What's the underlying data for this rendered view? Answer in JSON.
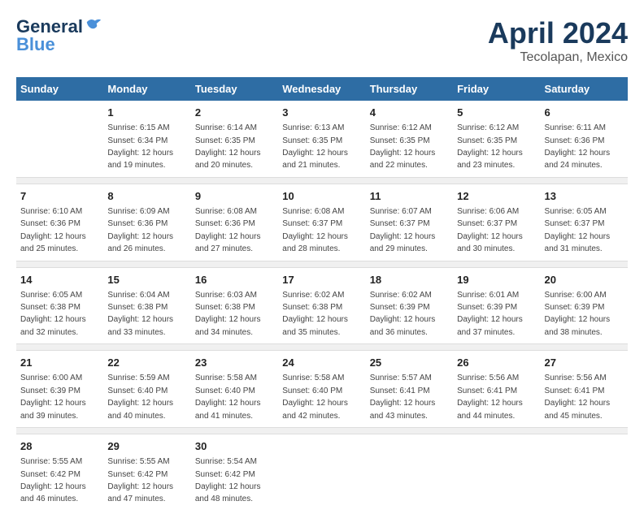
{
  "header": {
    "logo_general": "General",
    "logo_blue": "Blue",
    "title": "April 2024",
    "subtitle": "Tecolapan, Mexico"
  },
  "days_of_week": [
    "Sunday",
    "Monday",
    "Tuesday",
    "Wednesday",
    "Thursday",
    "Friday",
    "Saturday"
  ],
  "weeks": [
    [
      {
        "day": "",
        "sunrise": "",
        "sunset": "",
        "daylight": ""
      },
      {
        "day": "1",
        "sunrise": "Sunrise: 6:15 AM",
        "sunset": "Sunset: 6:34 PM",
        "daylight": "Daylight: 12 hours and 19 minutes."
      },
      {
        "day": "2",
        "sunrise": "Sunrise: 6:14 AM",
        "sunset": "Sunset: 6:35 PM",
        "daylight": "Daylight: 12 hours and 20 minutes."
      },
      {
        "day": "3",
        "sunrise": "Sunrise: 6:13 AM",
        "sunset": "Sunset: 6:35 PM",
        "daylight": "Daylight: 12 hours and 21 minutes."
      },
      {
        "day": "4",
        "sunrise": "Sunrise: 6:12 AM",
        "sunset": "Sunset: 6:35 PM",
        "daylight": "Daylight: 12 hours and 22 minutes."
      },
      {
        "day": "5",
        "sunrise": "Sunrise: 6:12 AM",
        "sunset": "Sunset: 6:35 PM",
        "daylight": "Daylight: 12 hours and 23 minutes."
      },
      {
        "day": "6",
        "sunrise": "Sunrise: 6:11 AM",
        "sunset": "Sunset: 6:36 PM",
        "daylight": "Daylight: 12 hours and 24 minutes."
      }
    ],
    [
      {
        "day": "7",
        "sunrise": "Sunrise: 6:10 AM",
        "sunset": "Sunset: 6:36 PM",
        "daylight": "Daylight: 12 hours and 25 minutes."
      },
      {
        "day": "8",
        "sunrise": "Sunrise: 6:09 AM",
        "sunset": "Sunset: 6:36 PM",
        "daylight": "Daylight: 12 hours and 26 minutes."
      },
      {
        "day": "9",
        "sunrise": "Sunrise: 6:08 AM",
        "sunset": "Sunset: 6:36 PM",
        "daylight": "Daylight: 12 hours and 27 minutes."
      },
      {
        "day": "10",
        "sunrise": "Sunrise: 6:08 AM",
        "sunset": "Sunset: 6:37 PM",
        "daylight": "Daylight: 12 hours and 28 minutes."
      },
      {
        "day": "11",
        "sunrise": "Sunrise: 6:07 AM",
        "sunset": "Sunset: 6:37 PM",
        "daylight": "Daylight: 12 hours and 29 minutes."
      },
      {
        "day": "12",
        "sunrise": "Sunrise: 6:06 AM",
        "sunset": "Sunset: 6:37 PM",
        "daylight": "Daylight: 12 hours and 30 minutes."
      },
      {
        "day": "13",
        "sunrise": "Sunrise: 6:05 AM",
        "sunset": "Sunset: 6:37 PM",
        "daylight": "Daylight: 12 hours and 31 minutes."
      }
    ],
    [
      {
        "day": "14",
        "sunrise": "Sunrise: 6:05 AM",
        "sunset": "Sunset: 6:38 PM",
        "daylight": "Daylight: 12 hours and 32 minutes."
      },
      {
        "day": "15",
        "sunrise": "Sunrise: 6:04 AM",
        "sunset": "Sunset: 6:38 PM",
        "daylight": "Daylight: 12 hours and 33 minutes."
      },
      {
        "day": "16",
        "sunrise": "Sunrise: 6:03 AM",
        "sunset": "Sunset: 6:38 PM",
        "daylight": "Daylight: 12 hours and 34 minutes."
      },
      {
        "day": "17",
        "sunrise": "Sunrise: 6:02 AM",
        "sunset": "Sunset: 6:38 PM",
        "daylight": "Daylight: 12 hours and 35 minutes."
      },
      {
        "day": "18",
        "sunrise": "Sunrise: 6:02 AM",
        "sunset": "Sunset: 6:39 PM",
        "daylight": "Daylight: 12 hours and 36 minutes."
      },
      {
        "day": "19",
        "sunrise": "Sunrise: 6:01 AM",
        "sunset": "Sunset: 6:39 PM",
        "daylight": "Daylight: 12 hours and 37 minutes."
      },
      {
        "day": "20",
        "sunrise": "Sunrise: 6:00 AM",
        "sunset": "Sunset: 6:39 PM",
        "daylight": "Daylight: 12 hours and 38 minutes."
      }
    ],
    [
      {
        "day": "21",
        "sunrise": "Sunrise: 6:00 AM",
        "sunset": "Sunset: 6:39 PM",
        "daylight": "Daylight: 12 hours and 39 minutes."
      },
      {
        "day": "22",
        "sunrise": "Sunrise: 5:59 AM",
        "sunset": "Sunset: 6:40 PM",
        "daylight": "Daylight: 12 hours and 40 minutes."
      },
      {
        "day": "23",
        "sunrise": "Sunrise: 5:58 AM",
        "sunset": "Sunset: 6:40 PM",
        "daylight": "Daylight: 12 hours and 41 minutes."
      },
      {
        "day": "24",
        "sunrise": "Sunrise: 5:58 AM",
        "sunset": "Sunset: 6:40 PM",
        "daylight": "Daylight: 12 hours and 42 minutes."
      },
      {
        "day": "25",
        "sunrise": "Sunrise: 5:57 AM",
        "sunset": "Sunset: 6:41 PM",
        "daylight": "Daylight: 12 hours and 43 minutes."
      },
      {
        "day": "26",
        "sunrise": "Sunrise: 5:56 AM",
        "sunset": "Sunset: 6:41 PM",
        "daylight": "Daylight: 12 hours and 44 minutes."
      },
      {
        "day": "27",
        "sunrise": "Sunrise: 5:56 AM",
        "sunset": "Sunset: 6:41 PM",
        "daylight": "Daylight: 12 hours and 45 minutes."
      }
    ],
    [
      {
        "day": "28",
        "sunrise": "Sunrise: 5:55 AM",
        "sunset": "Sunset: 6:42 PM",
        "daylight": "Daylight: 12 hours and 46 minutes."
      },
      {
        "day": "29",
        "sunrise": "Sunrise: 5:55 AM",
        "sunset": "Sunset: 6:42 PM",
        "daylight": "Daylight: 12 hours and 47 minutes."
      },
      {
        "day": "30",
        "sunrise": "Sunrise: 5:54 AM",
        "sunset": "Sunset: 6:42 PM",
        "daylight": "Daylight: 12 hours and 48 minutes."
      },
      {
        "day": "",
        "sunrise": "",
        "sunset": "",
        "daylight": ""
      },
      {
        "day": "",
        "sunrise": "",
        "sunset": "",
        "daylight": ""
      },
      {
        "day": "",
        "sunrise": "",
        "sunset": "",
        "daylight": ""
      },
      {
        "day": "",
        "sunrise": "",
        "sunset": "",
        "daylight": ""
      }
    ]
  ]
}
